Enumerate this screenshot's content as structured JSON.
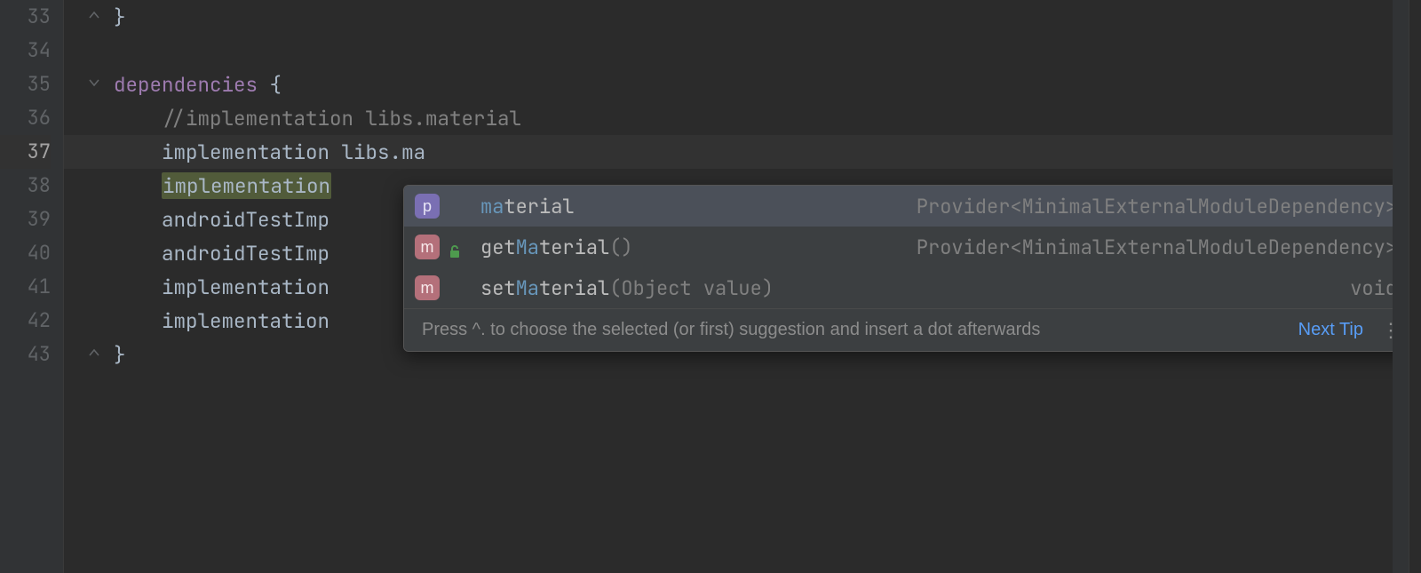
{
  "gutter": {
    "start": 33,
    "end": 43,
    "active": 37
  },
  "code": {
    "lines": [
      {
        "n": 33,
        "fold": "end",
        "segs": [
          {
            "cls": "tok-punc",
            "txt": "}"
          }
        ],
        "indent": 0
      },
      {
        "n": 34,
        "segs": []
      },
      {
        "n": 35,
        "fold": "start",
        "segs": [
          {
            "cls": "tok-keyword",
            "txt": "dependencies"
          },
          {
            "cls": "tok-punc",
            "txt": " {"
          }
        ],
        "indent": 0
      },
      {
        "n": 36,
        "segs": [
          {
            "cls": "tok-comment",
            "txt": "//implementation libs.material"
          }
        ],
        "indent": 1
      },
      {
        "n": 37,
        "active": true,
        "segs": [
          {
            "cls": "tok-ident",
            "txt": "implementation"
          },
          {
            "cls": "tok-ident",
            "txt": " libs"
          },
          {
            "cls": "tok-punc",
            "txt": "."
          },
          {
            "cls": "tok-member",
            "txt": "ma"
          }
        ],
        "indent": 1
      },
      {
        "n": 38,
        "segs": [
          {
            "cls": "tok-ident tok-sel-bg",
            "txt": "implementation"
          }
        ],
        "indent": 1
      },
      {
        "n": 39,
        "segs": [
          {
            "cls": "tok-ident",
            "txt": "androidTestImp"
          }
        ],
        "indent": 1
      },
      {
        "n": 40,
        "segs": [
          {
            "cls": "tok-ident",
            "txt": "androidTestImp"
          }
        ],
        "indent": 1
      },
      {
        "n": 41,
        "segs": [
          {
            "cls": "tok-ident",
            "txt": "implementation"
          }
        ],
        "indent": 1
      },
      {
        "n": 42,
        "segs": [
          {
            "cls": "tok-ident",
            "txt": "implementation"
          }
        ],
        "indent": 1
      },
      {
        "n": 43,
        "fold": "end",
        "segs": [
          {
            "cls": "tok-punc",
            "txt": "}"
          }
        ],
        "indent": 0
      }
    ]
  },
  "completion": {
    "items": [
      {
        "selected": true,
        "badge": "p",
        "badge_class": "badge-p",
        "access_icon": false,
        "match": "ma",
        "rest": "terial",
        "signature": "",
        "type": "Provider<MinimalExternalModuleDependency>"
      },
      {
        "selected": false,
        "badge": "m",
        "badge_class": "badge-m",
        "access_icon": true,
        "prefix": "get",
        "match": "Ma",
        "rest": "terial",
        "signature": "()",
        "type": "Provider<MinimalExternalModuleDependency>"
      },
      {
        "selected": false,
        "badge": "m",
        "badge_class": "badge-m",
        "access_icon": false,
        "prefix": "set",
        "match": "Ma",
        "rest": "terial",
        "signature": "(Object value)",
        "type": "void"
      }
    ],
    "footer_hint": "Press ^. to choose the selected (or first) suggestion and insert a dot afterwards",
    "footer_link": "Next Tip"
  }
}
